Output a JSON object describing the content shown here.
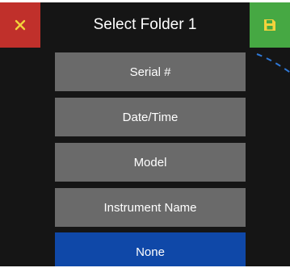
{
  "header": {
    "title": "Select Folder 1",
    "close_icon": "x-icon",
    "save_icon": "floppy-disk-icon"
  },
  "options": [
    {
      "label": "Serial #",
      "selected": false
    },
    {
      "label": "Date/Time",
      "selected": false
    },
    {
      "label": "Model",
      "selected": false
    },
    {
      "label": "Instrument Name",
      "selected": false
    },
    {
      "label": "None",
      "selected": true
    }
  ],
  "colors": {
    "header_bg": "#151515",
    "close_bg": "#c0302b",
    "save_bg": "#46a843",
    "option_bg": "#6a6a6a",
    "selected_bg": "#0f48a8",
    "decoration": "#2f78d6"
  }
}
